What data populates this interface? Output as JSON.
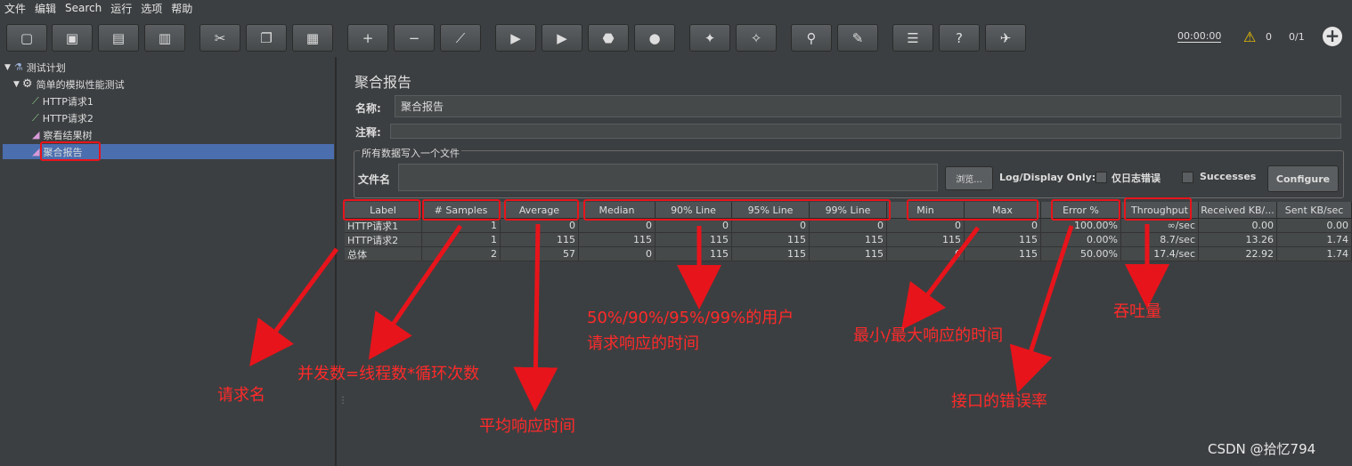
{
  "menu": [
    "文件",
    "编辑",
    "Search",
    "运行",
    "选项",
    "帮助"
  ],
  "toolbar": {
    "buttons": [
      {
        "name": "new-icon",
        "glyph": "▢"
      },
      {
        "name": "templates-icon",
        "glyph": "▣"
      },
      {
        "name": "open-icon",
        "glyph": "▤"
      },
      {
        "name": "save-icon",
        "glyph": "▥"
      },
      {
        "name": "cut-icon",
        "glyph": "✂"
      },
      {
        "name": "copy-icon",
        "glyph": "❐"
      },
      {
        "name": "paste-icon",
        "glyph": "▦"
      },
      {
        "name": "expand-icon",
        "glyph": "+"
      },
      {
        "name": "collapse-icon",
        "glyph": "−"
      },
      {
        "name": "toggle-icon",
        "glyph": "⟋"
      },
      {
        "name": "start-icon",
        "glyph": "▶"
      },
      {
        "name": "start-no-pause-icon",
        "glyph": "▶"
      },
      {
        "name": "stop-icon",
        "glyph": "⬣"
      },
      {
        "name": "shutdown-icon",
        "glyph": "●"
      },
      {
        "name": "clear-icon",
        "glyph": "✦"
      },
      {
        "name": "clear-all-icon",
        "glyph": "✧"
      },
      {
        "name": "search-icon",
        "glyph": "⚲"
      },
      {
        "name": "reset-search-icon",
        "glyph": "✎"
      },
      {
        "name": "function-helper-icon",
        "glyph": "☰"
      },
      {
        "name": "help-icon",
        "glyph": "?"
      },
      {
        "name": "remote-icon",
        "glyph": "✈"
      }
    ],
    "timer": "00:00:00",
    "warning_count": "0",
    "threads": "0/1"
  },
  "tree": [
    {
      "label": "测试计划",
      "level": 0,
      "icon": "flask-icon"
    },
    {
      "label": "简单的模拟性能测试",
      "level": 1,
      "icon": "gear-icon"
    },
    {
      "label": "HTTP请求1",
      "level": 2,
      "icon": "pipette-icon"
    },
    {
      "label": "HTTP请求2",
      "level": 2,
      "icon": "pipette-icon"
    },
    {
      "label": "察看结果树",
      "level": 2,
      "icon": "chart-icon"
    },
    {
      "label": "聚合报告",
      "level": 2,
      "icon": "chart-icon"
    }
  ],
  "panel": {
    "title": "聚合报告",
    "name_label": "名称:",
    "name_value": "聚合报告",
    "comment_label": "注释:",
    "group_title": "所有数据写入一个文件",
    "file_label": "文件名",
    "browse_label": "浏览...",
    "logonly_label": "Log/Display Only:",
    "errors_label": "仅日志错误",
    "successes_label": "Successes",
    "configure_label": "Configure"
  },
  "table": {
    "headers": [
      "Label",
      "# Samples",
      "Average",
      "Median",
      "90% Line",
      "95% Line",
      "99% Line",
      "Min",
      "Max",
      "Error %",
      "Throughput",
      "Received KB/...",
      "Sent KB/sec"
    ],
    "rows": [
      [
        "HTTP请求1",
        "1",
        "0",
        "0",
        "0",
        "0",
        "0",
        "0",
        "0",
        "100.00%",
        "∞/sec",
        "0.00",
        "0.00"
      ],
      [
        "HTTP请求2",
        "1",
        "115",
        "115",
        "115",
        "115",
        "115",
        "115",
        "115",
        "0.00%",
        "8.7/sec",
        "13.26",
        "1.74"
      ],
      [
        "总体",
        "2",
        "57",
        "0",
        "115",
        "115",
        "115",
        "0",
        "115",
        "50.00%",
        "17.4/sec",
        "22.92",
        "1.74"
      ]
    ]
  },
  "annotations": {
    "label": "请求名",
    "samples": "并发数=线程数*循环次数",
    "average": "平均响应时间",
    "percentiles_line1": "50%/90%/95%/99%的用户",
    "percentiles_line2": "请求响应的时间",
    "minmax": "最小/最大响应的时间",
    "error": "接口的错误率",
    "throughput": "吞吐量"
  },
  "accent_color": "#e8141b",
  "watermark": "CSDN @拾忆794"
}
